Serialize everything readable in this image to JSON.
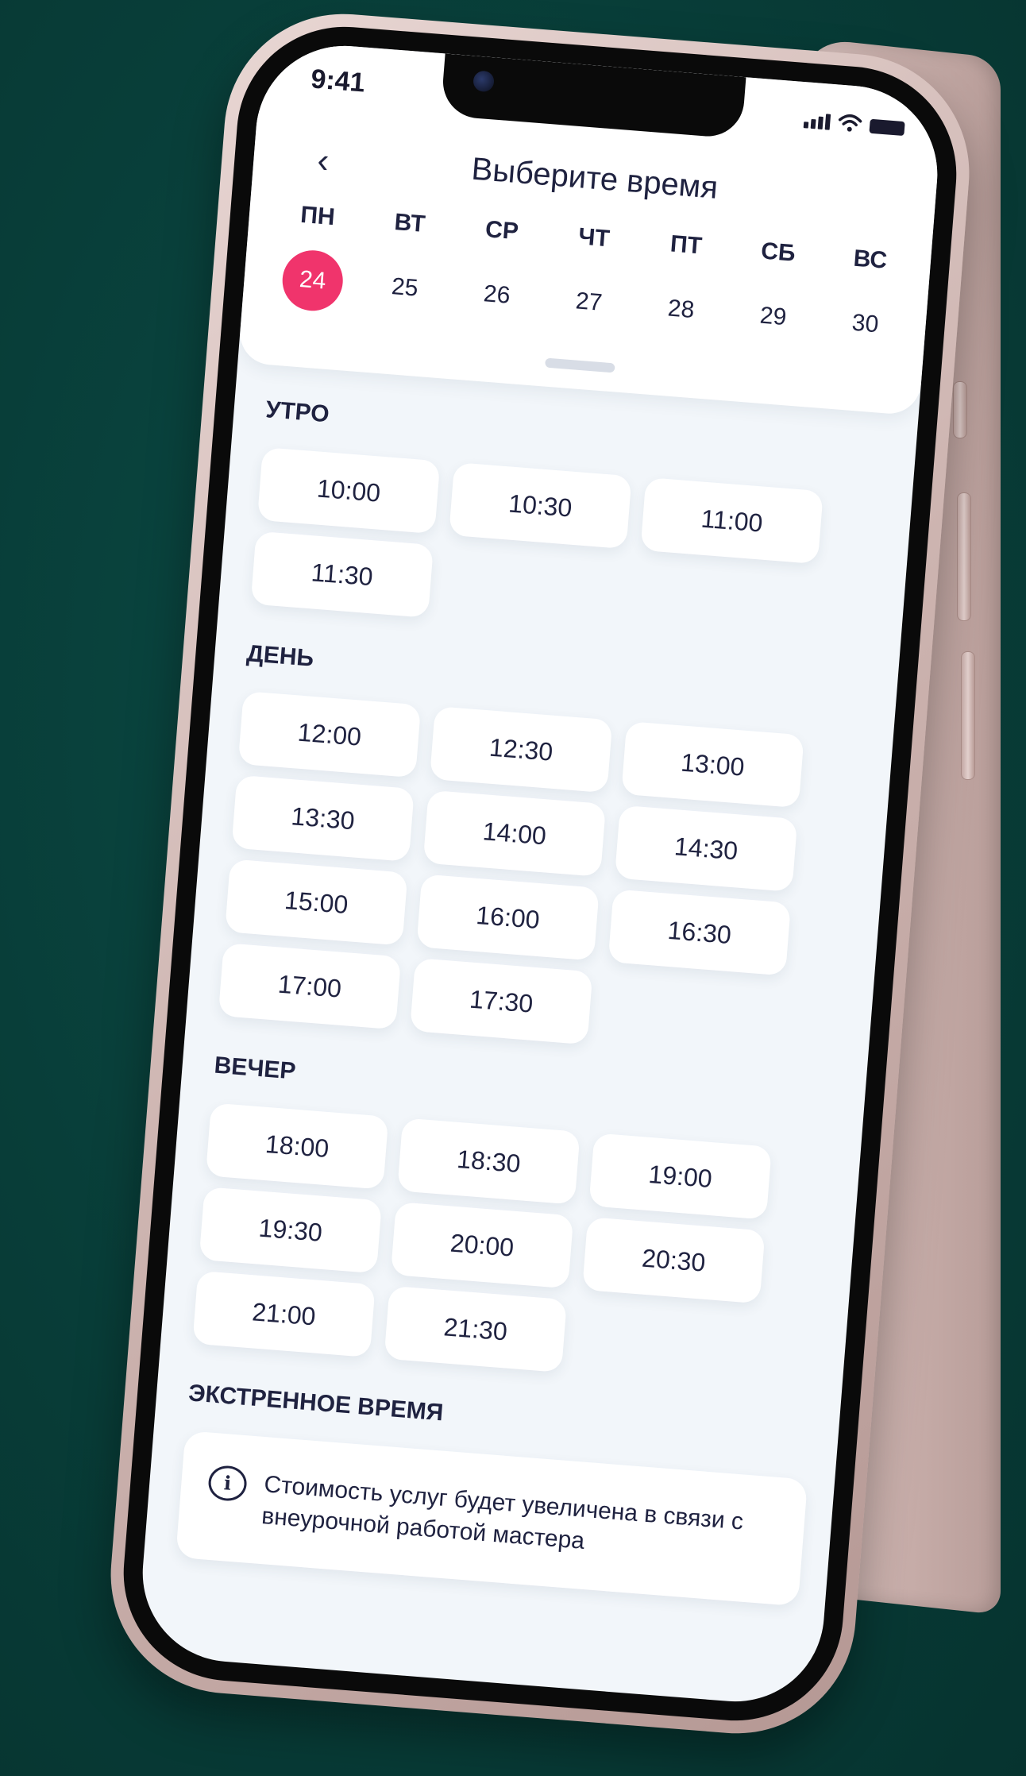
{
  "status": {
    "time": "9:41"
  },
  "header": {
    "back_icon": "‹",
    "title": "Выберите время"
  },
  "week": [
    {
      "name": "ПН",
      "num": "24",
      "selected": true
    },
    {
      "name": "ВТ",
      "num": "25"
    },
    {
      "name": "СР",
      "num": "26"
    },
    {
      "name": "ЧТ",
      "num": "27"
    },
    {
      "name": "ПТ",
      "num": "28"
    },
    {
      "name": "СБ",
      "num": "29"
    },
    {
      "name": "ВС",
      "num": "30"
    }
  ],
  "sections": [
    {
      "label": "УТРО",
      "slots": [
        "10:00",
        "10:30",
        "11:00",
        "11:30"
      ]
    },
    {
      "label": "ДЕНЬ",
      "slots": [
        "12:00",
        "12:30",
        "13:00",
        "13:30",
        "14:00",
        "14:30",
        "15:00",
        "16:00",
        "16:30",
        "17:00",
        "17:30"
      ]
    },
    {
      "label": "ВЕЧЕР",
      "slots": [
        "18:00",
        "18:30",
        "19:00",
        "19:30",
        "20:00",
        "20:30",
        "21:00",
        "21:30"
      ]
    }
  ],
  "emergency": {
    "label": "ЭКСТРЕННОЕ ВРЕМЯ",
    "notice": "Стоимость услуг будет увеличена в связи с внеурочной работой мастера"
  },
  "colors": {
    "accent": "#f0346c",
    "background": "#083d38",
    "text": "#1f2240"
  }
}
